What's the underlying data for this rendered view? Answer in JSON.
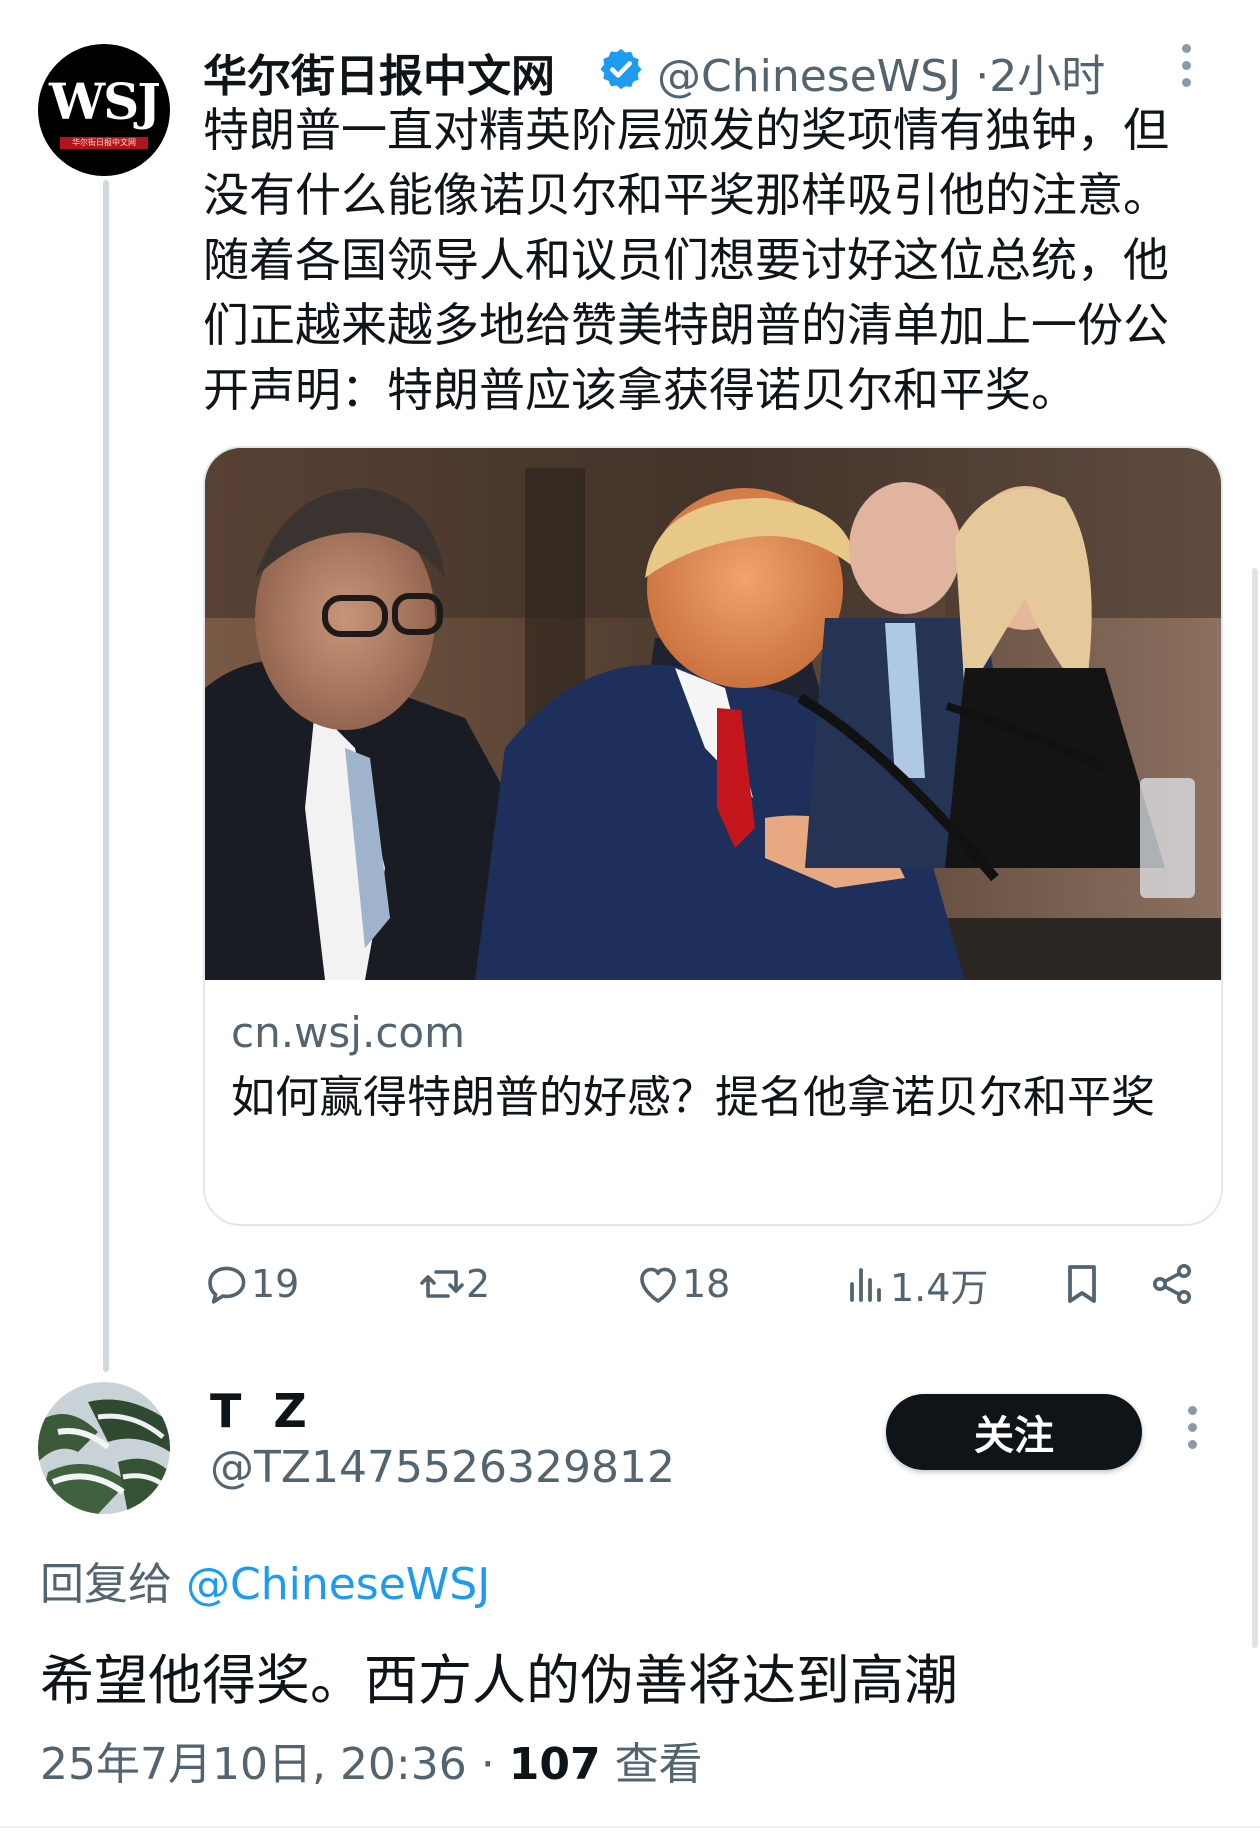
{
  "tweet": {
    "author_name": "华尔街日报中文网",
    "avatar_text": "WSJ",
    "avatar_subtext": "华尔街日报中文网",
    "handle": "@ChineseWSJ",
    "separator": "·",
    "time": "2小时",
    "text": "特朗普一直对精英阶层颁发的奖项情有独钟，但\n没有什么能像诺贝尔和平奖那样吸引他的注意。\n随着各国领导人和议员们想要讨好这位总统，他\n们正越来越多地给赞美特朗普的清单加上一份公\n开声明：特朗普应该拿获得诺贝尔和平奖。",
    "card": {
      "domain": "cn.wsj.com",
      "title": "如何赢得特朗普的好感？提名他拿诺贝尔和平奖"
    },
    "stats": {
      "replies": "19",
      "retweets": "2",
      "likes": "18",
      "views": "1.4万"
    }
  },
  "reply": {
    "author_name": "T Z",
    "handle": "@TZ1475526329812",
    "follow_label": "关注",
    "reply_to_label": "回复给",
    "reply_to_handle": "@ChineseWSJ",
    "text": "希望他得奖。西方人的伪善将达到高潮",
    "date": "25年7月10日, 20:36",
    "separator": "·",
    "view_count": "107",
    "view_label": "查看"
  },
  "colors": {
    "accent": "#1d9bf0",
    "muted": "#536471",
    "text": "#0f1419",
    "button_bg": "#0f1419"
  }
}
